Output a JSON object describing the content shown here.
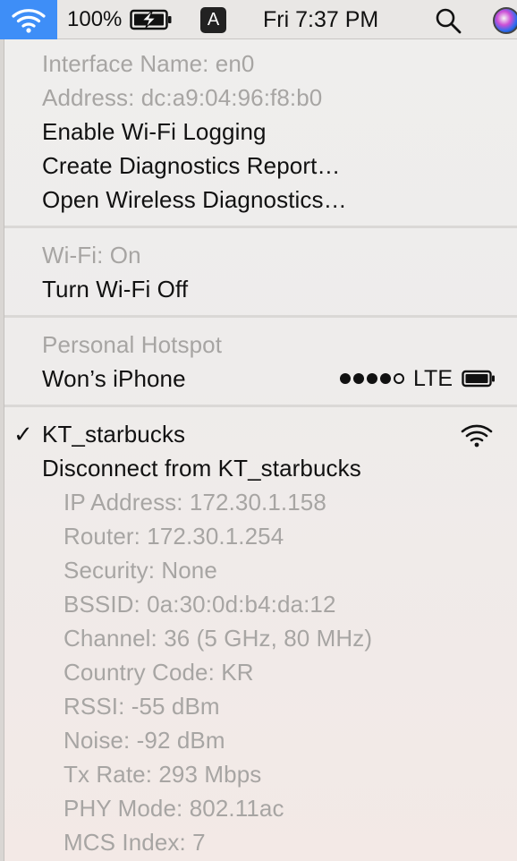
{
  "menubar": {
    "battery_percent": "100%",
    "input_source": "A",
    "clock": "Fri 7:37 PM",
    "icons": [
      "wifi-icon",
      "battery-charging-icon",
      "input-source-icon",
      "search-icon",
      "siri-icon"
    ],
    "accent_color": "#3e8ef7"
  },
  "menu": {
    "interface_name": "Interface Name: en0",
    "address": "Address: dc:a9:04:96:f8:b0",
    "enable_logging": "Enable Wi-Fi Logging",
    "create_report": "Create Diagnostics Report…",
    "open_diagnostics": "Open Wireless Diagnostics…",
    "wifi_status": "Wi-Fi: On",
    "turn_off": "Turn Wi-Fi Off",
    "hotspot_header": "Personal Hotspot",
    "hotspot_device": "Won’s iPhone",
    "hotspot_signal_bars": 4,
    "hotspot_signal_max": 5,
    "hotspot_network": "LTE",
    "check_mark": "✓",
    "connected_network": "KT_starbucks",
    "disconnect": "Disconnect from KT_starbucks",
    "details": [
      "IP Address: 172.30.1.158",
      "Router: 172.30.1.254",
      "Security: None",
      "BSSID: 0a:30:0d:b4:da:12",
      "Channel: 36 (5 GHz, 80 MHz)",
      "Country Code: KR",
      "RSSI: -55 dBm",
      "Noise: -92 dBm",
      "Tx Rate: 293 Mbps",
      "PHY Mode: 802.11ac",
      "MCS Index: 7"
    ]
  }
}
